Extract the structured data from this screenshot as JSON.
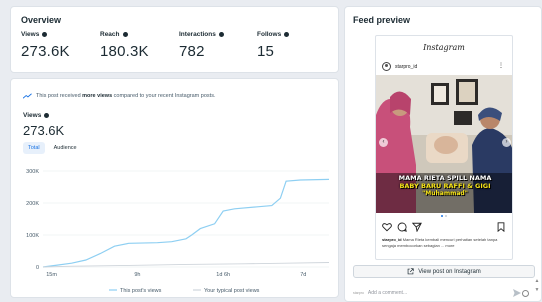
{
  "overview": {
    "title": "Overview",
    "metrics": [
      {
        "label": "Views",
        "value": "273.6K"
      },
      {
        "label": "Reach",
        "value": "180.3K"
      },
      {
        "label": "Interactions",
        "value": "782"
      },
      {
        "label": "Follows",
        "value": "15"
      }
    ]
  },
  "views_card": {
    "notice_prefix": "This post received ",
    "notice_bold": "more views",
    "notice_suffix": " compared to your recent Instagram posts.",
    "label": "Views",
    "value": "273.6K",
    "tabs": [
      {
        "label": "Total",
        "active": true
      },
      {
        "label": "Audience",
        "active": false
      }
    ]
  },
  "chart_data": {
    "type": "line",
    "x_ticks": [
      "15m",
      "9h",
      "1d 6h",
      "7d"
    ],
    "y_ticks": [
      "0",
      "100K",
      "200K",
      "300K"
    ],
    "ylim": [
      0,
      300000
    ],
    "series": [
      {
        "name": "This post's views",
        "color": "#8ecff2",
        "points": [
          [
            0,
            0
          ],
          [
            0.05,
            6000
          ],
          [
            0.1,
            12000
          ],
          [
            0.15,
            22000
          ],
          [
            0.2,
            42000
          ],
          [
            0.25,
            65000
          ],
          [
            0.3,
            74000
          ],
          [
            0.4,
            76000
          ],
          [
            0.45,
            79000
          ],
          [
            0.5,
            88000
          ],
          [
            0.52,
            100000
          ],
          [
            0.55,
            120000
          ],
          [
            0.6,
            135000
          ],
          [
            0.63,
            175000
          ],
          [
            0.67,
            182000
          ],
          [
            0.75,
            188000
          ],
          [
            0.8,
            192000
          ],
          [
            0.83,
            215000
          ],
          [
            0.85,
            268000
          ],
          [
            0.9,
            272000
          ],
          [
            1.0,
            273600
          ]
        ]
      },
      {
        "name": "Your typical post views",
        "color": "#cfd5db",
        "points": [
          [
            0,
            0
          ],
          [
            0.1,
            2500
          ],
          [
            0.3,
            5000
          ],
          [
            0.5,
            8000
          ],
          [
            0.7,
            10000
          ],
          [
            0.85,
            12000
          ],
          [
            1.0,
            14000
          ]
        ]
      }
    ],
    "grid": true,
    "legend": "bottom"
  },
  "feed": {
    "title": "Feed preview",
    "app_name": "Instagram",
    "username": "starpro_id",
    "caption_lines": [
      "MAMA RIETA SPILL NAMA",
      "BABY BARU RAFFI & GIGI"
    ],
    "caption_sub": "\"Muhammad\"",
    "post_text_user": "starpro_id",
    "post_text": "Mama Rieta kembali mencuri perhatian setelah tanpa sengaja membocorkan sebagian ... more",
    "view_button": "View post on Instagram",
    "comment_placeholder": "Add a comment...",
    "comment_badge": "starpro"
  },
  "colors": {
    "accent": "#1b74e4",
    "line": "#8ecff2",
    "typical": "#cfd5db"
  },
  "icons": [
    "info-icon",
    "trend-up-icon",
    "heart-icon",
    "comment-icon",
    "share-icon",
    "bookmark-icon",
    "external-link-icon",
    "send-icon",
    "emoji-icon"
  ]
}
